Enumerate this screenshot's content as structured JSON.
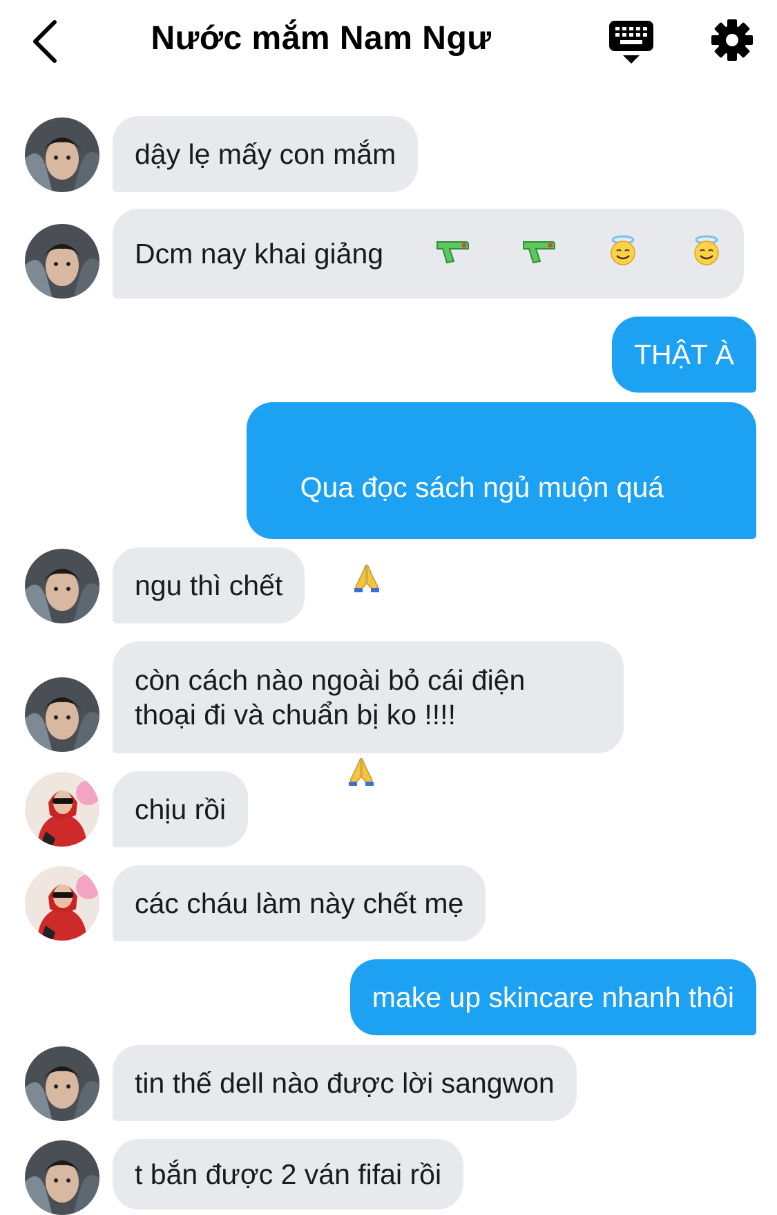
{
  "header": {
    "title": "Nước mắm Nam Ngư",
    "back_icon": "chevron-left-icon",
    "keyboard_icon": "keyboard-icon",
    "settings_icon": "gear-icon"
  },
  "colors": {
    "outgoing_bubble": "#1da1f2",
    "incoming_bubble": "#e8e9ec"
  },
  "messages": [
    {
      "sender": "friend_a",
      "direction": "incoming",
      "text": "dậy lẹ mấy con mắm"
    },
    {
      "sender": "friend_a",
      "direction": "incoming",
      "text": "Dcm nay khai giảng",
      "emojis": [
        "water-pistol-icon",
        "water-pistol-icon",
        "smiling-face-with-halo-icon",
        "smiling-face-with-halo-icon"
      ]
    },
    {
      "sender": "me",
      "direction": "outgoing",
      "text": "THẬT À"
    },
    {
      "sender": "me",
      "direction": "outgoing",
      "text": "Qua đọc sách ngủ muộn quá",
      "emojis": [
        "folded-hands-icon",
        "folded-hands-icon"
      ]
    },
    {
      "sender": "friend_a",
      "direction": "incoming",
      "text": "ngu thì chết"
    },
    {
      "sender": "friend_a",
      "direction": "incoming",
      "text": "còn cách nào ngoài bỏ cái điện\nthoại đi và chuẩn bị ko !!!!"
    },
    {
      "sender": "friend_b",
      "direction": "incoming",
      "text": "chịu rồi"
    },
    {
      "sender": "friend_b",
      "direction": "incoming",
      "text": "các cháu làm này chết mẹ"
    },
    {
      "sender": "me",
      "direction": "outgoing",
      "text": "make up skincare nhanh thôi"
    },
    {
      "sender": "friend_a",
      "direction": "incoming",
      "text": "tin thế dell nào được lời sangwon"
    },
    {
      "sender": "friend_a",
      "direction": "incoming",
      "text": "t bắn được 2 ván fifai rồi"
    }
  ]
}
